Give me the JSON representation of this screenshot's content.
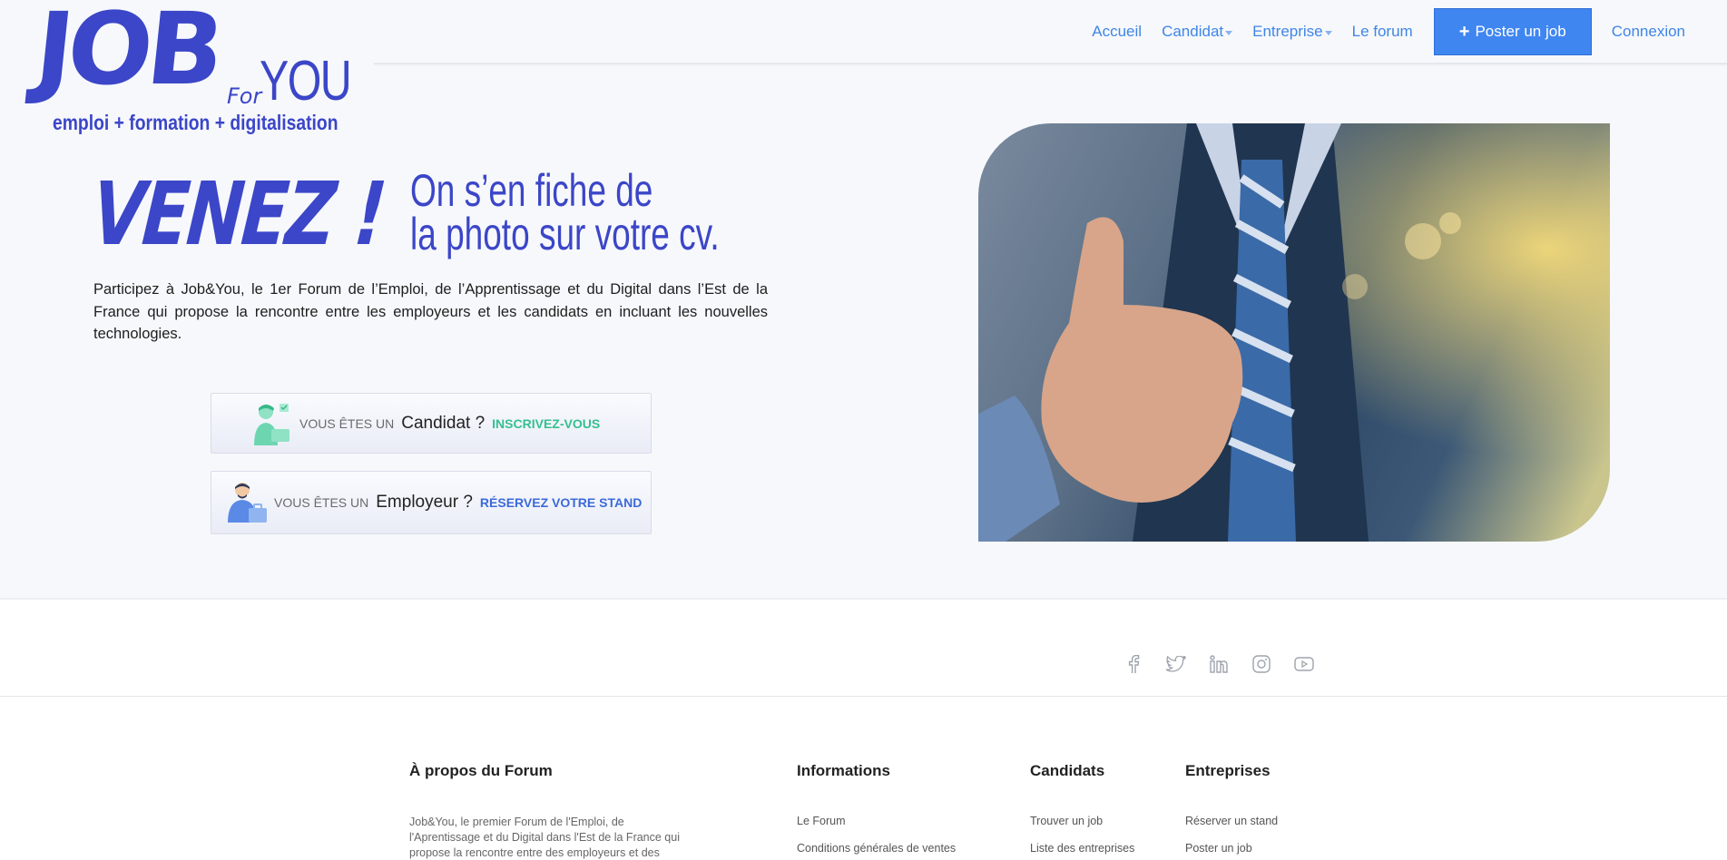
{
  "brand": {
    "logo_job": "JOB",
    "logo_for": "For",
    "logo_you": "YOU",
    "tagline": "emploi + formation + digitalisation"
  },
  "nav": {
    "accueil": "Accueil",
    "candidat": "Candidat",
    "entreprise": "Entreprise",
    "forum": "Le forum",
    "post_job": "Poster un job",
    "login": "Connexion"
  },
  "colors": {
    "brand": "#3b46c8",
    "link": "#3f86e6",
    "primary_button": "#3f86f0",
    "candidate_accent": "#35c08e",
    "employer_accent": "#3b6ad9"
  },
  "hero": {
    "headline": "VENEZ !",
    "slogan_line1": "On s’en fiche de",
    "slogan_line2": "la photo sur votre cv.",
    "intro": "Participez à Job&You, le 1er Forum de l’Emploi, de l’Apprentissage et du Digital dans l’Est de la France qui propose la rencontre entre les employeurs et les candidats en incluant les nouvelles technologies."
  },
  "cta_candidate": {
    "prefix": "VOUS ÊTES UN",
    "role": "Candidat ?",
    "action": "INSCRIVEZ-VOUS",
    "icon": "candidate-avatar-icon"
  },
  "cta_employer": {
    "prefix": "VOUS ÊTES UN",
    "role": "Employeur ?",
    "action": "RÉSERVEZ VOTRE STAND",
    "icon": "employer-avatar-icon"
  },
  "social": [
    "facebook-icon",
    "twitter-icon",
    "linkedin-icon",
    "instagram-icon",
    "youtube-icon"
  ],
  "footer": {
    "about": {
      "title": "À propos du Forum",
      "text": "Job&You, le premier Forum de l'Emploi, de l'Aprentissage et du Digital dans l'Est de la France qui propose la rencontre entre des employeurs et des"
    },
    "informations": {
      "title": "Informations",
      "links": [
        "Le Forum",
        "Conditions générales de ventes"
      ]
    },
    "candidats": {
      "title": "Candidats",
      "links": [
        "Trouver un job",
        "Liste des entreprises"
      ]
    },
    "entreprises": {
      "title": "Entreprises",
      "links": [
        "Réserver un stand",
        "Poster un job"
      ]
    }
  }
}
